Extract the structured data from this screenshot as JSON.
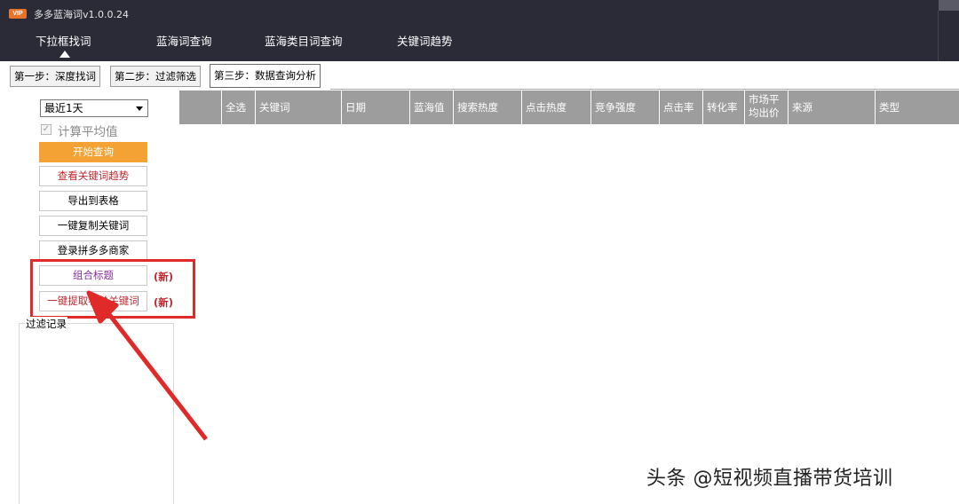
{
  "app": {
    "title": "多多蓝海词v1.0.0.24",
    "logo_text": "VIP"
  },
  "nav": {
    "items": [
      {
        "label": "下拉框找词"
      },
      {
        "label": "蓝海词查询"
      },
      {
        "label": "蓝海类目词查询"
      },
      {
        "label": "关键词趋势"
      }
    ],
    "active_index": 0
  },
  "steps": {
    "tabs": [
      {
        "label": "第一步：深度找词"
      },
      {
        "label": "第二步：过滤筛选"
      },
      {
        "label": "第三步：数据查询分析"
      }
    ],
    "active_index": 2
  },
  "controls": {
    "range_select": {
      "value": "最近1天"
    },
    "avg_checkbox": {
      "label": "计算平均值",
      "checked": true,
      "mark": "✓"
    },
    "buttons": {
      "start_query": "开始查询",
      "view_trend": "查看关键词趋势",
      "export_table": "导出到表格",
      "copy_keywords": "一键复制关键词",
      "login_merchant": "登录拼多多商家",
      "combine_title": "组合标题",
      "extract_keywords": "一键提取补单关键词"
    },
    "new_tag": "(新)"
  },
  "filter_log": {
    "label": "过滤记录"
  },
  "table": {
    "columns": [
      "",
      "全选",
      "关键词",
      "日期",
      "蓝海值",
      "搜索热度",
      "点击热度",
      "竞争强度",
      "点击率",
      "转化率",
      "市场平均出价",
      "来源",
      "类型"
    ]
  },
  "watermark": "头条 @短视频直播带货培训",
  "colors": {
    "header_bg": "#2b2b38",
    "accent_orange": "#f3a233",
    "highlight_red": "#e02a2a",
    "table_header": "#9d9d9d"
  }
}
